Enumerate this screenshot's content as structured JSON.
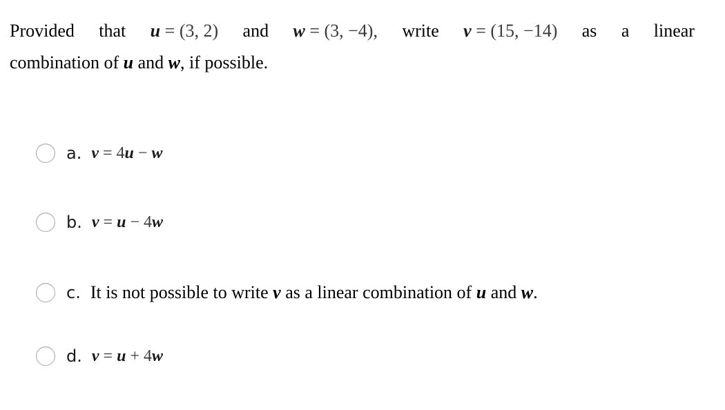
{
  "question": {
    "line1": {
      "provided": "Provided",
      "that": "that",
      "u_var": "u",
      "u_eq": " = ",
      "u_val": "(3, 2)",
      "and": "and",
      "w_var": "w",
      "w_eq": " = ",
      "w_val": "(3, −4),",
      "write": "write",
      "v_var": "v",
      "v_eq": " = ",
      "v_val": "(15, −14)",
      "as": "as",
      "a": "a",
      "linear": "linear"
    },
    "line2": {
      "prefix": "combination of ",
      "u_var": "u",
      "mid": " and ",
      "w_var": "w",
      "suffix": ", if possible."
    }
  },
  "options": [
    {
      "letter": "a.",
      "selected": false,
      "lhs": "v",
      "eq": " = 4",
      "t1": "u",
      "op": " − ",
      "t2": "w"
    },
    {
      "letter": "b.",
      "selected": false,
      "lhs": "v",
      "eq": " = ",
      "t1": "u",
      "op": " − 4",
      "t2": "w"
    },
    {
      "letter": "c.",
      "selected": false,
      "text_prefix": "It is not possible to write ",
      "v_var": "v",
      "text_mid": " as a linear combination of ",
      "u_var": "u",
      "text_and": " and ",
      "w_var": "w",
      "text_suffix": "."
    },
    {
      "letter": "d.",
      "selected": false,
      "lhs": "v",
      "eq": " = ",
      "t1": "u",
      "op": " + 4",
      "t2": "w"
    }
  ]
}
